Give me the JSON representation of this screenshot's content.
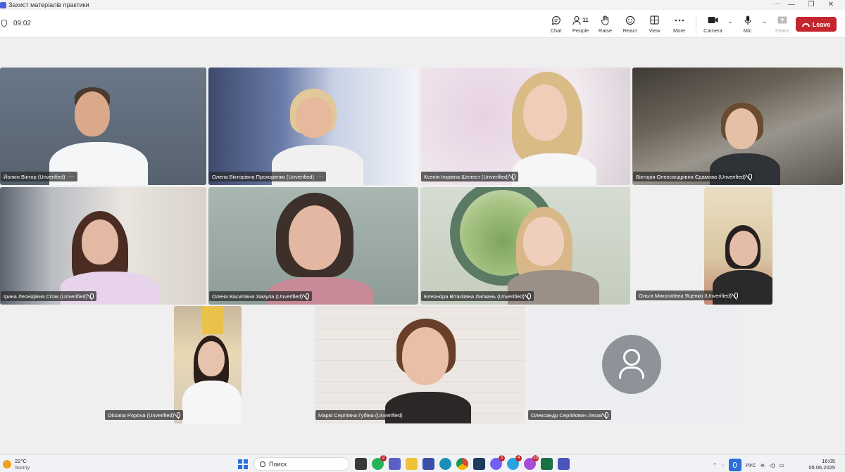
{
  "window": {
    "title": "Захист матеріалів практики",
    "controls": [
      "···",
      "—",
      "❐",
      "✕"
    ]
  },
  "meeting": {
    "elapsed": "09:02"
  },
  "toolbar": {
    "chat": "Chat",
    "people": "People",
    "people_count": "11",
    "raise": "Raise",
    "react": "React",
    "view": "View",
    "more": "More",
    "camera": "Camera",
    "mic": "Mic",
    "share": "Share",
    "leave": "Leave",
    "leave_color": "#c4262e"
  },
  "participants": [
    {
      "name": "Йолкін Віктор (Unverified)",
      "muted": false,
      "more": "···"
    },
    {
      "name": "Олена Вікторівна Прохоренко (Unverified)",
      "muted": false,
      "more": "···"
    },
    {
      "name": "Ксенія Ігорівна Шелест (Unverified)",
      "muted": true
    },
    {
      "name": "Вікторія Олександрівна Єдамова (Unverified)",
      "muted": true
    },
    {
      "name": "Ірина Леонідівна Сітак (Unverified)",
      "muted": true
    },
    {
      "name": "Олена Василівна Замула (Unverified)",
      "muted": true
    },
    {
      "name": "Елеонора Віталіївна Липкань (Unverified)",
      "muted": true
    },
    {
      "name": "Ольга Миколаївна Яценко (Unverified)",
      "muted": true
    },
    {
      "name": "Oksana Popova (Unverified)",
      "muted": true
    },
    {
      "name": "Марія Сергіївна Губіна (Unverified)",
      "muted": false,
      "active_speaker": true
    },
    {
      "name": "Олександр Сергійович Лесик",
      "muted": true,
      "camera_off": true
    }
  ],
  "taskbar": {
    "temperature": "22°C",
    "weather": "Sunny",
    "search_placeholder": "Поиск",
    "language": "РУС",
    "time": "16:05",
    "date": "05.06.2025",
    "badges": {
      "whatsapp": "2",
      "viber": "5",
      "telegram": "4",
      "messenger": "10"
    }
  },
  "accent_color": "#6e82d8"
}
